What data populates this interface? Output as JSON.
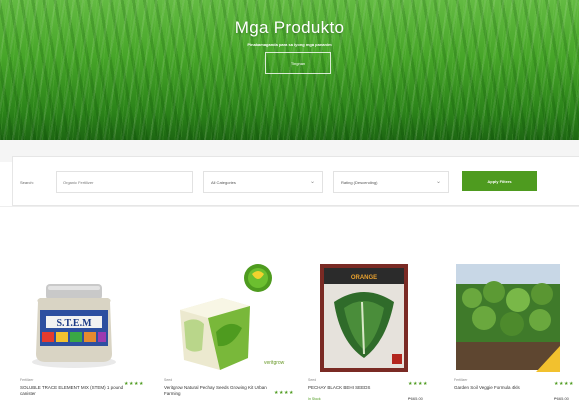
{
  "hero": {
    "title": "Mga Produkto",
    "subtitle": "Pinakamaganda para sa iyong mga pananim",
    "button_label": "Tingnan"
  },
  "filters": {
    "label": "Search:",
    "search_value": "Organic Fertilizer",
    "category_selected": "All Categories",
    "sort_selected": "Rating (Descending)",
    "apply_label": "Apply Filters"
  },
  "products": [
    {
      "brand": "Fertilizer",
      "name": "SOLUBLE TRACE ELEMENT MIX (STEM) 1 pound canister",
      "rating": 4,
      "stars": "★★★★",
      "price": ""
    },
    {
      "brand": "Seed",
      "name": "Veritgrow Natural Pechay Seeds Growing Kit Urban Farming",
      "rating": 4,
      "stars": "★★★★",
      "price": ""
    },
    {
      "brand": "Seed",
      "name": "PECHAY BLACK BEHI SEEDS",
      "stock": "In Stock",
      "rating": 4,
      "stars": "★★★★",
      "price": "₱665.00"
    },
    {
      "brand": "Fertilizer",
      "name": "Garden Soil Veggie Formula 4kls",
      "rating": 4,
      "stars": "★★★★",
      "price": "₱665.00"
    }
  ],
  "colors": {
    "accent": "#4e9b1f",
    "hero_green": "#4fb52e"
  }
}
